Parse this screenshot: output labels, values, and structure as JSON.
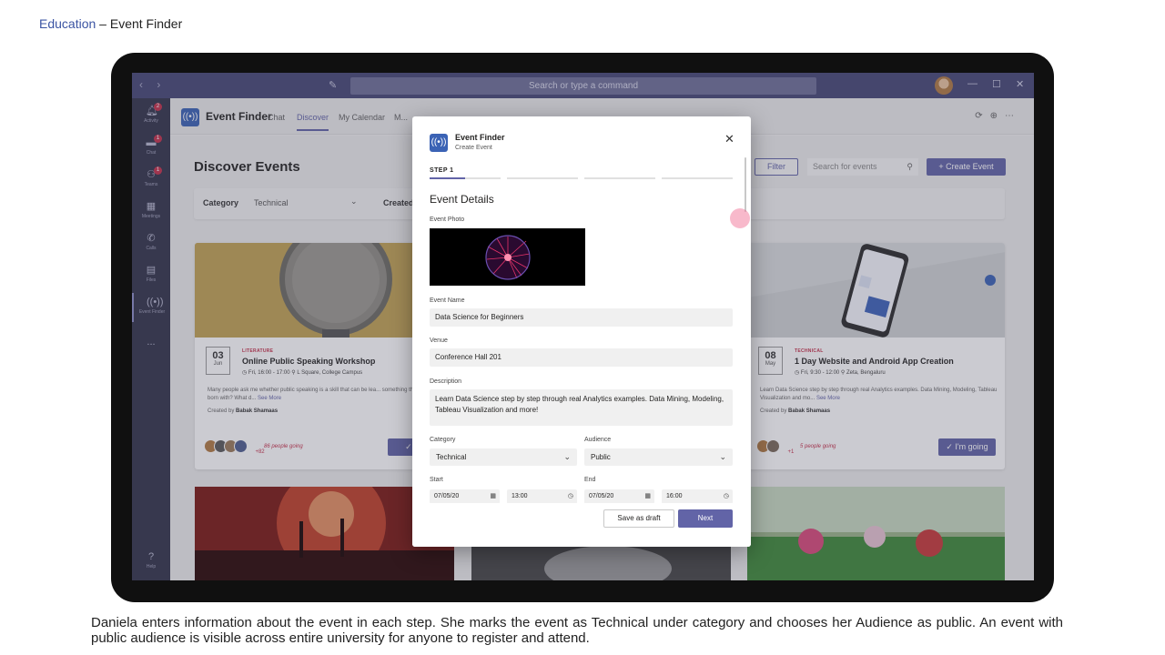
{
  "slide": {
    "crumb": "Education",
    "dash": " – ",
    "title": "Event Finder"
  },
  "caption": "Daniela enters information about the event in each step. She marks the event as Technical under category and chooses her Audience as public. An event with public audience is visible across entire university for anyone to register and attend.",
  "titlebar": {
    "nav": "‹ ›",
    "search_placeholder": "Search or type a command",
    "minimize": "—",
    "maximize": "☐",
    "close": "✕"
  },
  "rail": {
    "items": [
      {
        "label": "Activity",
        "badge": "2"
      },
      {
        "label": "Chat",
        "badge": "1"
      },
      {
        "label": "Teams",
        "badge": "1"
      },
      {
        "label": "Meetings",
        "badge": ""
      },
      {
        "label": "Calls",
        "badge": ""
      },
      {
        "label": "Files",
        "badge": ""
      },
      {
        "label": "Event Finder",
        "badge": ""
      },
      {
        "label": "...",
        "badge": ""
      },
      {
        "label": "Help",
        "badge": ""
      }
    ]
  },
  "apphead": {
    "name": "Event Finder",
    "tabs": [
      "Chat",
      "Discover",
      "My Calendar",
      "M..."
    ],
    "active_tab": "Discover"
  },
  "content": {
    "title": "Discover Events",
    "filter": {
      "category_label": "Category",
      "category_value": "Technical",
      "created_label": "Created"
    },
    "filter_button": "Filter",
    "search_placeholder": "Search for events",
    "create_button": "+ Create Event"
  },
  "cards": [
    {
      "day": "03",
      "month": "Jun",
      "category": "LITERATURE",
      "title": "Online Public Speaking Workshop",
      "time": "Fri, 16:00 - 17:00",
      "place": "L Square, College Campus",
      "desc": "Many people ask me whether public speaking is a skill that can be lea... something that we are born with? What d...",
      "more": "See More",
      "created_prefix": "Created by",
      "creator": "Babak Shamaas",
      "extra": "+82",
      "going": "86 people going",
      "button": "✓ I'm"
    },
    {
      "day": "08",
      "month": "May",
      "category": "TECHNICAL",
      "title": "1 Day Website and Android App Creation",
      "time": "Fri, 9:30 - 12:00",
      "place": "Zeta, Bengaluru",
      "desc": "Learn Data Science step by step through real Analytics examples. Data Mining, Modeling, Tableau Visualization and mo...",
      "more": "See More",
      "created_prefix": "Created by",
      "creator": "Babak Shamaas",
      "extra": "+1",
      "going": "5 people going",
      "button": "✓ I'm going"
    }
  ],
  "modal": {
    "app": "Event Finder",
    "subtitle": "Create Event",
    "close": "✕",
    "step": "STEP 1",
    "heading": "Event Details",
    "photo_label": "Event Photo",
    "name_label": "Event Name",
    "name_value": "Data Science for Beginners",
    "venue_label": "Venue",
    "venue_value": "Conference Hall 201",
    "desc_label": "Description",
    "desc_value": "Learn Data Science step by step through real Analytics examples. Data Mining, Modeling, Tableau Visualization and more!",
    "category_label": "Category",
    "category_value": "Technical",
    "audience_label": "Audience",
    "audience_value": "Public",
    "start_label": "Start",
    "end_label": "End",
    "start_date": "07/05/20",
    "start_time": "13:00",
    "end_date": "07/05/20",
    "end_time": "16:00",
    "draft_button": "Save as draft",
    "next_button": "Next"
  },
  "colors": {
    "accent": "#6264a7",
    "titlebar": "#464775",
    "rail": "#33344a",
    "badge": "#c4314b"
  }
}
